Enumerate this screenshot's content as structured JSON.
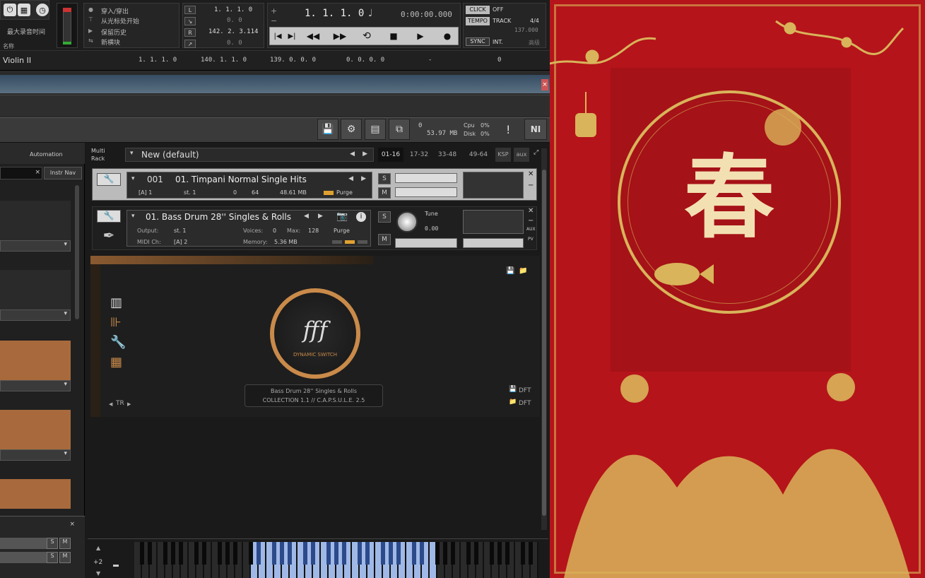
{
  "transport": {
    "menu_items": [
      "穿入/穿出",
      "从光标处开始",
      "保留历史",
      "新横块"
    ],
    "record_label": "最大录音时间",
    "positions": [
      "1. 1. 1.   0",
      "0.   0",
      "142. 2. 3.114",
      "0.   0"
    ],
    "main_position": "1. 1. 1.   0",
    "main_time": "0:00:00.000",
    "click_label": "CLICK",
    "click_value": "OFF",
    "tempo_label": "TEMPO",
    "tempo_mode": "TRACK",
    "signature": "4/4",
    "tempo": "137.000",
    "sync_label": "SYNC",
    "sync_value": "INT.",
    "sync_extra": "高级"
  },
  "track": {
    "name_header": "名称",
    "name": "Violin II",
    "cols": [
      "1. 1. 1.  0",
      "140. 1. 1.  0",
      "139. 0. 0.  0",
      "0. 0. 0.  0",
      "-",
      "0"
    ]
  },
  "kontakt": {
    "voices": "0",
    "memory": "53.97 MB",
    "cpu_label": "Cpu",
    "cpu": "0%",
    "disk_label": "Disk",
    "disk": "0%",
    "ni_logo": "NI"
  },
  "side": {
    "automation": "Automation",
    "instr_nav": "Instr Nav"
  },
  "rack": {
    "label": "Multi\nRack",
    "preset": "New (default)",
    "tabs": [
      "01-16",
      "17-32",
      "33-48",
      "49-64",
      "KSP",
      "aux"
    ]
  },
  "inst1": {
    "number": "001",
    "name": "01. Timpani Normal Single Hits",
    "midi": "[A]  1",
    "output": "st. 1",
    "voices": "0",
    "max": "64",
    "memory": "48.61 MB",
    "purge": "Purge",
    "s": "S",
    "m": "M"
  },
  "inst2": {
    "name": "01. Bass Drum 28'' Singles & Rolls",
    "output_label": "Output:",
    "output": "st. 1",
    "voices_label": "Voices:",
    "voices": "0",
    "max_label": "Max:",
    "max": "128",
    "purge": "Purge",
    "midi_label": "MIDI Ch:",
    "midi": "[A]  2",
    "memory_label": "Memory:",
    "memory": "5.36 MB",
    "tune_label": "Tune",
    "tune": "0.00",
    "s": "S",
    "m": "M",
    "aux": "AUX",
    "pv": "PV"
  },
  "ui": {
    "logo_text": "fff",
    "logo_sub": "DYNAMIC SWITCH",
    "info1": "Bass Drum 28'' Singles & Rolls",
    "info2": "COLLECTION 1.1  //  C.A.P.S.U.L.E. 2.5",
    "tr": "TR",
    "dft1": "DFT",
    "dft2": "DFT"
  },
  "keyboard": {
    "octave": "+2"
  },
  "poster": {
    "character": "春",
    "colors": {
      "red": "#b5141a",
      "gold": "#d9b45a"
    }
  },
  "accent": "#c98a4a"
}
